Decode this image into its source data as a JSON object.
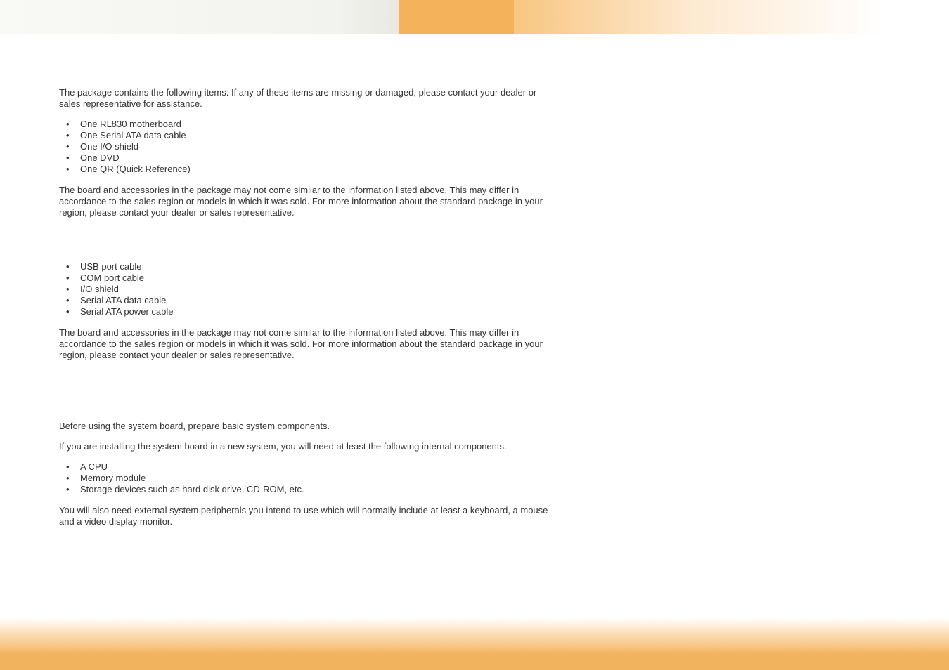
{
  "section1": {
    "intro": "The package contains the following items. If any of these items are missing or damaged, please contact your dealer or sales representative for assistance.",
    "items": [
      "One RL830 motherboard",
      "One Serial ATA data cable",
      "One I/O shield",
      "One DVD",
      "One QR (Quick Reference)"
    ],
    "note": "The board and accessories in the package may not come similar to the information listed above. This may differ in accordance to the sales region or models in which it was sold. For more information about the standard package in your region, please contact your dealer or sales representative."
  },
  "section2": {
    "items": [
      "USB port cable",
      "COM port cable",
      "I/O shield",
      "Serial ATA data cable",
      "Serial ATA power cable"
    ],
    "note": "The board and accessories in the package may not come similar to the information listed above. This may differ in accordance to the sales region or models in which it was sold. For more information about the standard package in your region, please contact your dealer or sales representative."
  },
  "section3": {
    "intro1": "Before using the system board, prepare basic system components.",
    "intro2": "If you are installing the system board in a new system, you will need at least the following internal components.",
    "items": [
      "A CPU",
      "Memory module",
      "Storage devices such as hard disk drive, CD-ROM, etc."
    ],
    "outro": "You will also need external system peripherals you intend to use which will normally include at least a keyboard, a mouse and a video display monitor."
  }
}
